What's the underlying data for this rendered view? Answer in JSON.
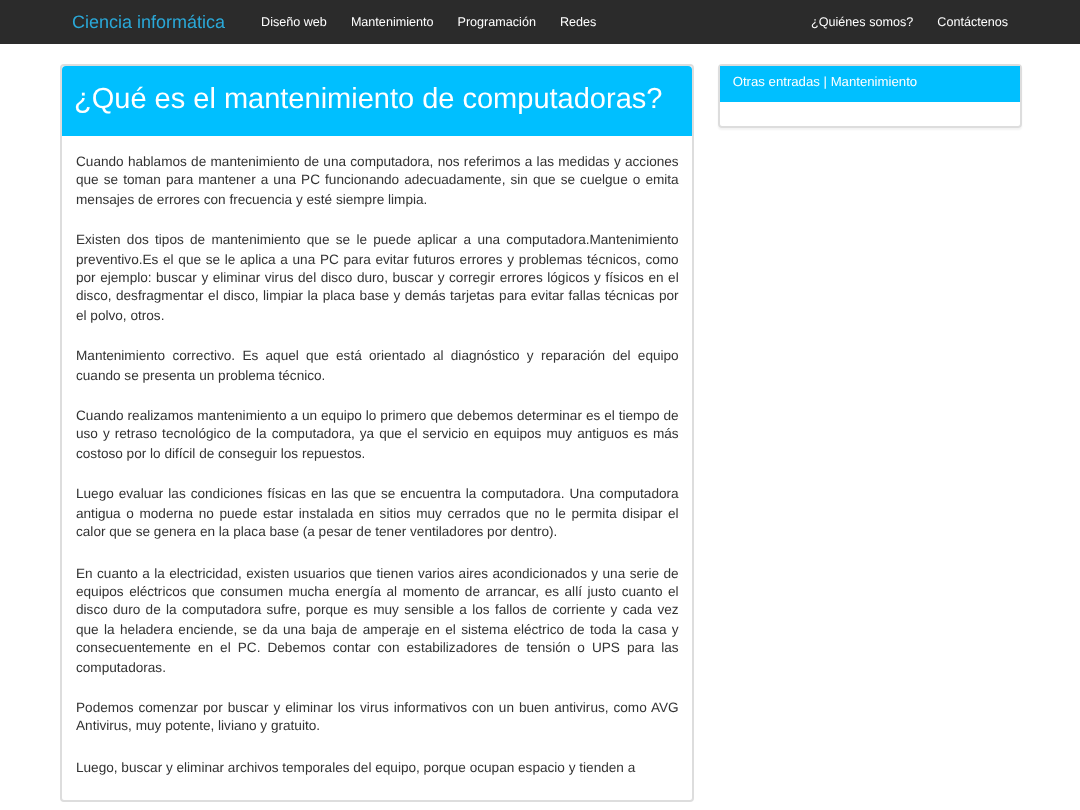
{
  "navbar": {
    "brand": "Ciencia informática",
    "links": [
      {
        "label": "Diseño web",
        "selected": false
      },
      {
        "label": "Mantenimiento",
        "selected": false
      },
      {
        "label": "Programación",
        "selected": false
      },
      {
        "label": "Redes",
        "selected": false
      }
    ],
    "right_links": [
      {
        "label": "¿Quiénes somos?",
        "selected": false
      },
      {
        "label": "Contáctenos",
        "selected": false
      }
    ]
  },
  "article": {
    "title": "¿Qué es el mantenimiento de computadoras?",
    "paragraphs": [
      "Cuando hablamos de mantenimiento de una computadora, nos referimos a las medidas y acciones que se toman para mantener a una PC funcionando adecuadamente, sin que se cuelgue o emita mensajes de errores con frecuencia y esté siempre limpia.",
      "Existen dos tipos de mantenimiento que se le puede aplicar a una computadora.Mantenimiento preventivo.Es el que se le aplica a una PC para evitar futuros errores y problemas técnicos, como por ejemplo: buscar y eliminar virus del disco duro, buscar y corregir errores lógicos y físicos en el disco, desfragmentar el disco, limpiar la placa base y demás tarjetas para evitar fallas técnicas por el polvo, otros.",
      "Mantenimiento correctivo. Es aquel que está orientado al diagnóstico y reparación del equipo cuando se presenta un problema técnico.",
      "Cuando realizamos mantenimiento a un equipo lo primero que debemos determinar es el tiempo de uso y retraso tecnológico de la computadora, ya que el servicio en equipos muy antiguos es más costoso por lo difícil de conseguir los repuestos.",
      "Luego evaluar las condiciones físicas en las que se encuentra la computadora. Una computadora antigua o moderna no puede estar instalada en sitios muy cerrados que no le permita disipar el calor que se genera en la placa base (a pesar de tener ventiladores por dentro).",
      "En cuanto a la electricidad, existen usuarios que tienen varios aires acondicionados y una serie de equipos eléctricos que consumen mucha energía al momento de arrancar, es allí justo cuanto el disco duro de la computadora sufre, porque es muy sensible a los fallos de corriente y cada vez que la heladera enciende, se da una baja de amperaje en el sistema eléctrico de toda la casa y consecuentemente en el PC. Debemos contar con estabilizadores de tensión o UPS para las computadoras.",
      "Podemos comenzar por buscar y eliminar los virus informativos con un buen antivirus, como AVG Antivirus, muy potente, liviano y gratuito.",
      "Luego, buscar y eliminar archivos temporales del equipo, porque ocupan espacio y tienden a"
    ]
  },
  "sidebar": {
    "title": "Otras entradas | Mantenimiento"
  }
}
